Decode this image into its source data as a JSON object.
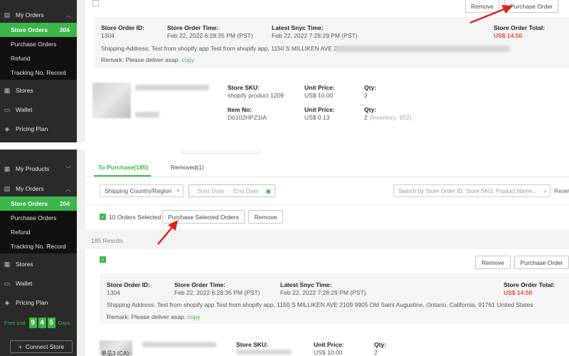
{
  "sidebar": {
    "my_products": "My Products",
    "my_orders": "My Orders",
    "store_orders": "Store Orders",
    "store_orders_count": "204",
    "purchase_orders": "Purchase Orders",
    "refund": "Refund",
    "tracking": "Tracking No. Record",
    "stores": "Stores",
    "wallet": "Wallet",
    "pricing_plan": "Pricing Plan",
    "free_trial": "Free trial",
    "trial_digits": [
      "9",
      "4",
      "5"
    ],
    "days": "Days",
    "connect_store": "Connect Store"
  },
  "top": {
    "remove": "Remove",
    "purchase_order": "Purchase Order",
    "store_order_id_label": "Store Order ID:",
    "store_order_id": "1304",
    "store_order_time_label": "Store Order Time:",
    "store_order_time": "Feb 22, 2022 6:28:35 PM (PST)",
    "latest_sync_label": "Latest Snyc Time:",
    "latest_sync": "Feb 22, 2022 7:28:29 PM (PST)",
    "store_total_label": "Store Order Total:",
    "store_total": "US$ 14.50",
    "shipping": "Shipping Address: Test from shopify app Test from shopify app, 1150 S MILLIKEN AVE 210",
    "remark": "Remark: Please deliver asap.",
    "copy": "copy",
    "store_sku_label": "Store SKU:",
    "store_sku": "shopify product 1209",
    "unit_price_label": "Unit Price:",
    "unit_price": "US$ 10.00",
    "qty_label": "Qty:",
    "qty": "2",
    "item_no_label": "Item No:",
    "item_no": "D0102HPZ1IA",
    "unit_price2_label": "Unit Price:",
    "unit_price2": "US$ 0.13",
    "qty2_label": "Qty:",
    "qty2": "2",
    "inventory": "(Inventory: 652)"
  },
  "bottom": {
    "tab_to_purchase": "To Purchase(185)",
    "tab_removed": "Removed(1)",
    "shipping_filter": "Shipping Country/Region",
    "start_date": "Start Date",
    "date_sep": "-",
    "end_date": "End Date",
    "search_placeholder": "Search by Store Order ID, Store SKU, Product Name...",
    "reset": "Reset",
    "selected": "10 Orders Selected",
    "purchase_selected": "Purchase Selected Orders",
    "remove": "Remove",
    "results": "185 Results",
    "remove2": "Remove",
    "purchase_order": "Purchase Order",
    "store_order_id_label": "Store Order ID:",
    "store_order_id": "1304",
    "store_order_time_label": "Store Order Time:",
    "store_order_time": "Feb 22, 2022 6:28:35 PM (PST)",
    "latest_sync_label": "Latest Snyc Time:",
    "latest_sync": "Feb 22, 2022 7:28:29 PM (PST)",
    "store_total_label": "Store Order Total:",
    "store_total": "US$ 14.50",
    "shipping": "Shipping Address: Test from shopify app Test from shopify app, 1150 S MILLIKEN AVE 2109 9905 Old Saint Augustine, Ontario, California, 91761 United States",
    "remark": "Remark: Please deliver asap.",
    "copy": "copy",
    "product_title": "单品3 (CA)",
    "store_sku_label": "Store SKU:",
    "unit_price_label": "Unit Price:",
    "unit_price": "US$ 10.00",
    "qty_label": "Qty:",
    "qty": "2"
  },
  "colors": {
    "accent": "#3db54a",
    "arrow": "#e02020",
    "total": "#e84a3c"
  }
}
